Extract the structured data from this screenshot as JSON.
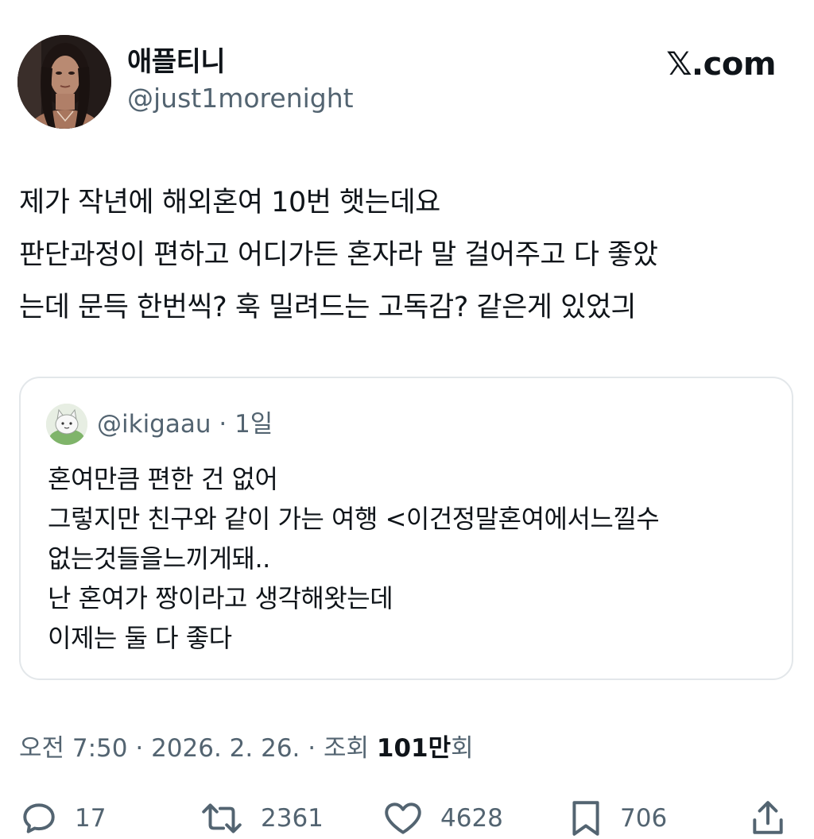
{
  "author": {
    "display_name": "애플티니",
    "handle": "@just1morenight"
  },
  "brand": "𝕏.com",
  "tweet": {
    "lines": [
      "제가 작년에 해외혼여 10번 햇는데요",
      "판단과정이 편하고 어디가든 혼자라 말 걸어주고 다 좋았",
      "는데 문득 한번씩? 훅 밀려드는 고독감? 같은게 있었긔"
    ]
  },
  "quote": {
    "handle": "@ikigaau",
    "separator": " · ",
    "time": "1일",
    "lines": [
      "혼여만큼 편한 건 없어",
      "그렇지만 친구와 같이 가는 여행 <이건정말혼여에서느낄수",
      "없는것들을느끼게돼..",
      "난 혼여가 짱이라고 생각해왓는데",
      "이제는 둘 다 좋다"
    ]
  },
  "meta": {
    "time": "오전 7:50",
    "separator": " · ",
    "date": "2026. 2. 26.",
    "views_label": "조회",
    "views_number": "101만",
    "views_suffix": "회"
  },
  "actions": {
    "replies": "17",
    "reposts": "2361",
    "likes": "4628",
    "bookmarks": "706"
  },
  "icons": {
    "reply": "reply-icon",
    "repost": "repost-icon",
    "like": "heart-icon",
    "bookmark": "bookmark-icon",
    "share": "share-icon"
  }
}
